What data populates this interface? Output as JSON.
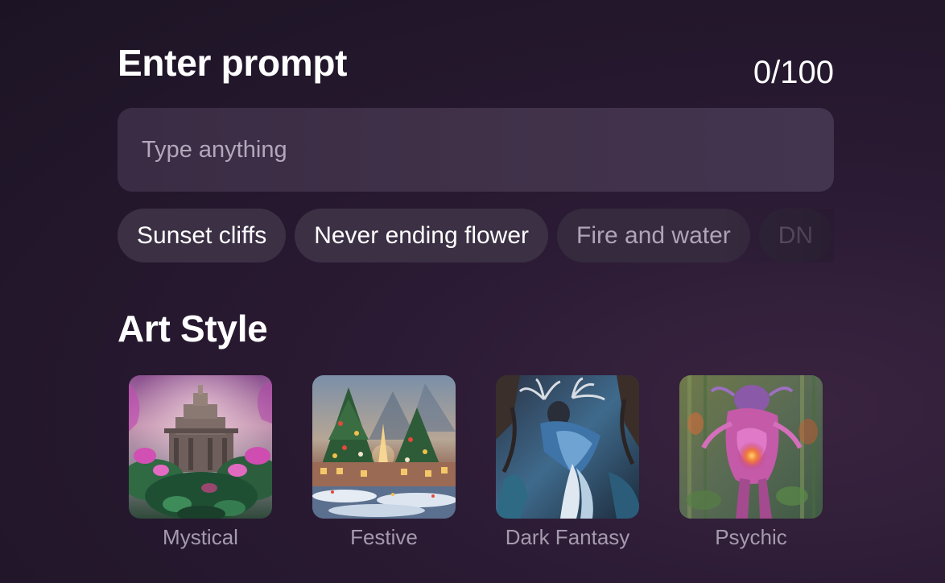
{
  "prompt": {
    "title": "Enter prompt",
    "counter": "0/100",
    "placeholder": "Type anything",
    "value": ""
  },
  "suggestions": [
    {
      "label": "Sunset cliffs"
    },
    {
      "label": "Never ending flower"
    },
    {
      "label": "Fire and water"
    },
    {
      "label": "DN"
    }
  ],
  "art_style": {
    "title": "Art Style",
    "styles": [
      {
        "label": "Mystical",
        "image": "temple-in-misty-jungle"
      },
      {
        "label": "Festive",
        "image": "christmas-trees-snowy-village"
      },
      {
        "label": "Dark Fantasy",
        "image": "dark-figure-with-antlers"
      },
      {
        "label": "Psychic",
        "image": "glowing-creature-in-forest"
      }
    ]
  },
  "colors": {
    "background": "#1c1424",
    "input_background": "#3d2f47",
    "chip_background": "#3c3045",
    "label_muted": "#a59aae",
    "placeholder": "#b3a8bb"
  }
}
